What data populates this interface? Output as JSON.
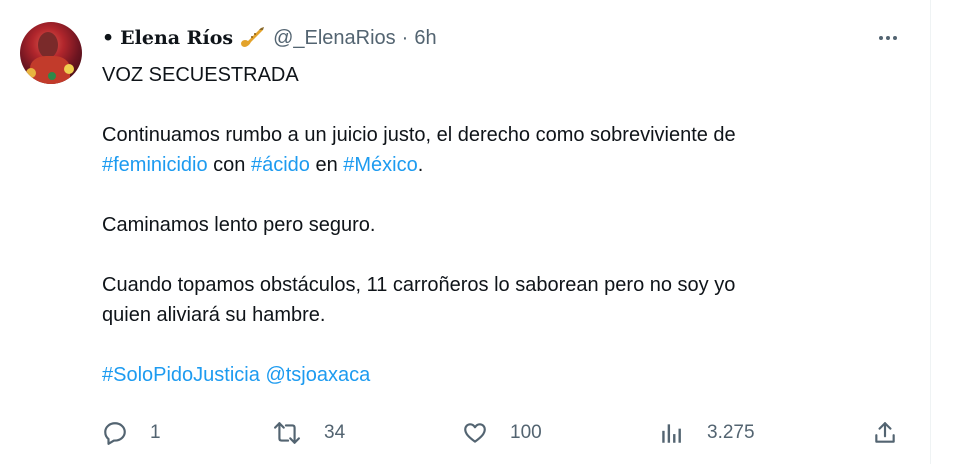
{
  "tweet": {
    "author_name": "Elena Ríos",
    "author_handle": "@_ElenaRios",
    "separator": "·",
    "time": "6h",
    "bullet": "•",
    "lines": {
      "title": "VOZ SECUESTRADA",
      "p1_text": "Continuamos rumbo a un juicio justo, el derecho como sobreviviente de",
      "p1_tag1": "#feminicidio",
      "p1_con": " con ",
      "p1_tag2": "#ácido",
      "p1_en": " en ",
      "p1_tag3": "#México",
      "p1_end": ".",
      "p2": "Caminamos lento pero seguro.",
      "p3_line1": "Cuando topamos obstáculos, 11 carroñeros lo saborean pero no soy yo",
      "p3_line2": "quien aliviará su hambre.",
      "tag_justicia": "#SoloPidoJusticia",
      "space": " ",
      "mention": "@tsjoaxaca"
    },
    "stats": {
      "replies": "1",
      "retweets": "34",
      "likes": "100",
      "views": "3.275"
    }
  },
  "colors": {
    "link": "#1d9bf0",
    "text": "#0f1419",
    "secondary": "#536471"
  },
  "icons": [
    "avatar",
    "saxophone-icon",
    "more-icon",
    "reply-icon",
    "retweet-icon",
    "like-icon",
    "views-icon",
    "share-icon"
  ]
}
